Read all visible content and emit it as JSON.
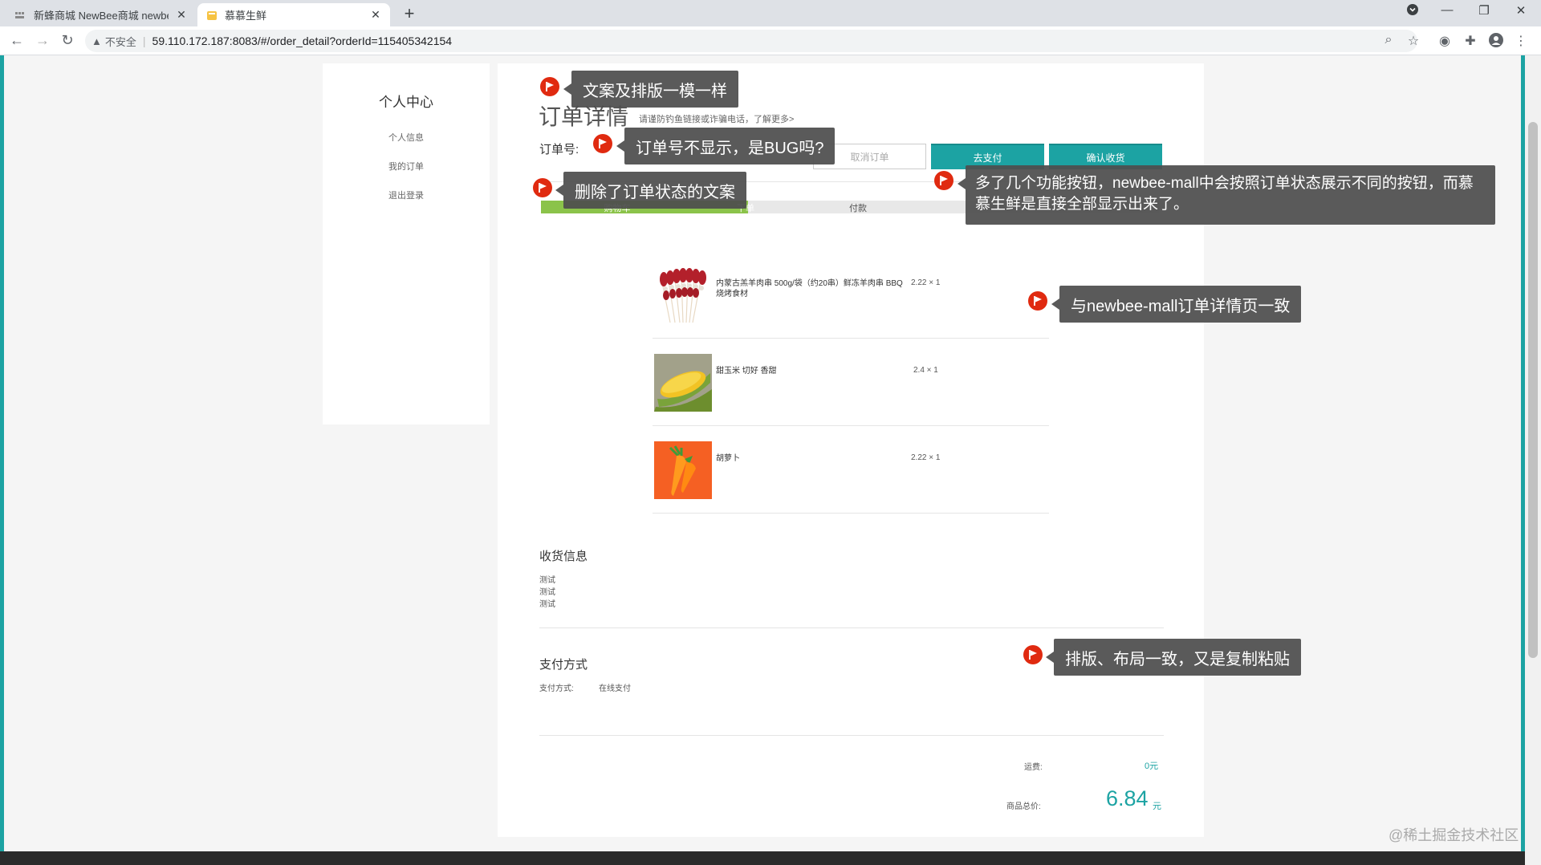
{
  "browser": {
    "tabs": [
      {
        "title": "新蜂商城 NewBee商城 newbee",
        "favicon": "newbee-logo-icon"
      },
      {
        "title": "慕慕生鲜",
        "favicon": "mumu-logo-icon"
      }
    ],
    "address": {
      "security": "不安全",
      "url": "59.110.172.187:8083/#/order_detail?orderId=115405342154"
    }
  },
  "sidebar": {
    "title": "个人中心",
    "items": [
      {
        "label": "个人信息"
      },
      {
        "label": "我的订单"
      },
      {
        "label": "退出登录"
      }
    ]
  },
  "order": {
    "heading": "订单详情",
    "tip": "请谨防钓鱼链接或诈骗电话，了解更多>",
    "number_label": "订单号:",
    "number_value": "",
    "buttons": {
      "cancel": "取消订单",
      "pay": "去支付",
      "confirm": "确认收货"
    },
    "progress": {
      "steps": [
        "购物车",
        "下单",
        "付款"
      ],
      "completed_fraction": 0.335
    },
    "items": [
      {
        "name": "内蒙古羔羊肉串 500g/袋（约20串）鲜冻羊肉串 BBQ烧烤食材",
        "price": "2.22 × 1",
        "image": "lamb-skewers-image"
      },
      {
        "name": "甜玉米 切好 香甜",
        "price": "2.4 × 1",
        "image": "sweet-corn-image"
      },
      {
        "name": "胡萝卜",
        "price": "2.22 × 1",
        "image": "carrot-image"
      }
    ],
    "shipping": {
      "title": "收货信息",
      "lines": [
        "测试",
        "测试",
        "测试"
      ]
    },
    "payment": {
      "title": "支付方式",
      "label": "支付方式:",
      "value": "在线支付"
    },
    "summary": {
      "freight_label": "运费:",
      "freight_value": "0元",
      "total_label": "商品总价:",
      "total_value": "6.84",
      "total_unit": "元"
    }
  },
  "callouts": [
    {
      "text": "文案及排版一模一样"
    },
    {
      "text": "订单号不显示，是BUG吗?"
    },
    {
      "text": "删除了订单状态的文案"
    },
    {
      "text": "多了几个功能按钮，newbee-mall中会按照订单状态展示不同的按钮，而慕慕生鲜是直接全部显示出来了。"
    },
    {
      "text": "与newbee-mall订单详情页一致"
    },
    {
      "text": "排版、布局一致，又是复制粘贴"
    }
  ],
  "watermark": "@稀土掘金技术社区",
  "colors": {
    "accent": "#1ca3a3",
    "progress": "#8bc34a",
    "flag": "#e02a10"
  }
}
